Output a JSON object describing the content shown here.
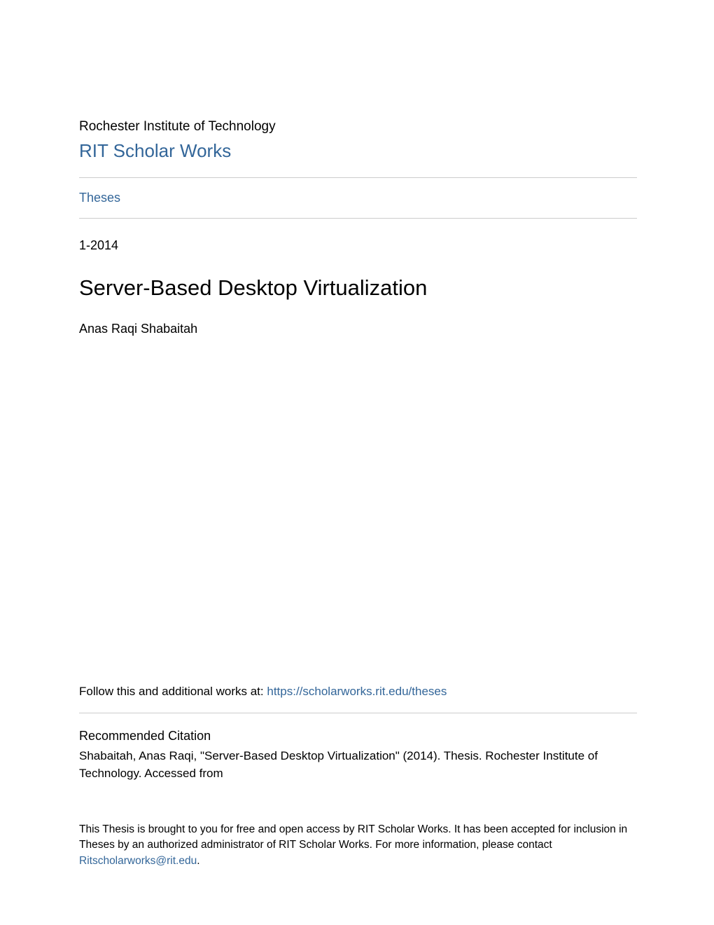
{
  "header": {
    "institution": "Rochester Institute of Technology",
    "repository_name": "RIT Scholar Works"
  },
  "nav": {
    "theses_label": "Theses"
  },
  "meta": {
    "date": "1-2014",
    "title": "Server-Based Desktop Virtualization",
    "author": "Anas Raqi Shabaitah"
  },
  "follow": {
    "prefix": "Follow this and additional works at: ",
    "link_text": "https://scholarworks.rit.edu/theses"
  },
  "citation": {
    "heading": "Recommended Citation",
    "text": "Shabaitah, Anas Raqi, \"Server-Based Desktop Virtualization\" (2014). Thesis. Rochester Institute of Technology. Accessed from"
  },
  "footer": {
    "text_before_email": "This Thesis is brought to you for free and open access by RIT Scholar Works. It has been accepted for inclusion in Theses by an authorized administrator of RIT Scholar Works. For more information, please contact ",
    "email": "Ritscholarworks@rit.edu",
    "text_after_email": "."
  },
  "colors": {
    "link": "#336699",
    "text": "#000000",
    "divider": "#cccccc"
  }
}
